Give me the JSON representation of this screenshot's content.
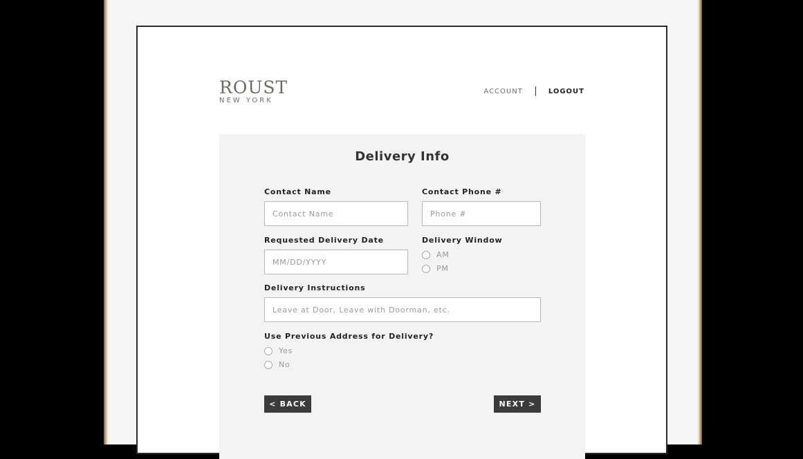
{
  "brand": {
    "name": "ROUST",
    "subtitle": "NEW YORK"
  },
  "nav": {
    "account": "ACCOUNT",
    "logout": "LOGOUT"
  },
  "form": {
    "title": "Delivery Info",
    "contact_name": {
      "label": "Contact Name",
      "placeholder": "Contact Name"
    },
    "contact_phone": {
      "label": "Contact Phone #",
      "placeholder": "Phone #"
    },
    "delivery_date": {
      "label": "Requested Delivery Date",
      "placeholder": "MM/DD/YYYY"
    },
    "delivery_window": {
      "label": "Delivery Window",
      "options": [
        "AM",
        "PM"
      ]
    },
    "instructions": {
      "label": "Delivery Instructions",
      "placeholder": "Leave at Door, Leave with Doorman, etc."
    },
    "previous_address": {
      "label": "Use Previous Address for Delivery?",
      "options": [
        "Yes",
        "No"
      ]
    },
    "back_label": "< BACK",
    "next_label": "NEXT >"
  }
}
